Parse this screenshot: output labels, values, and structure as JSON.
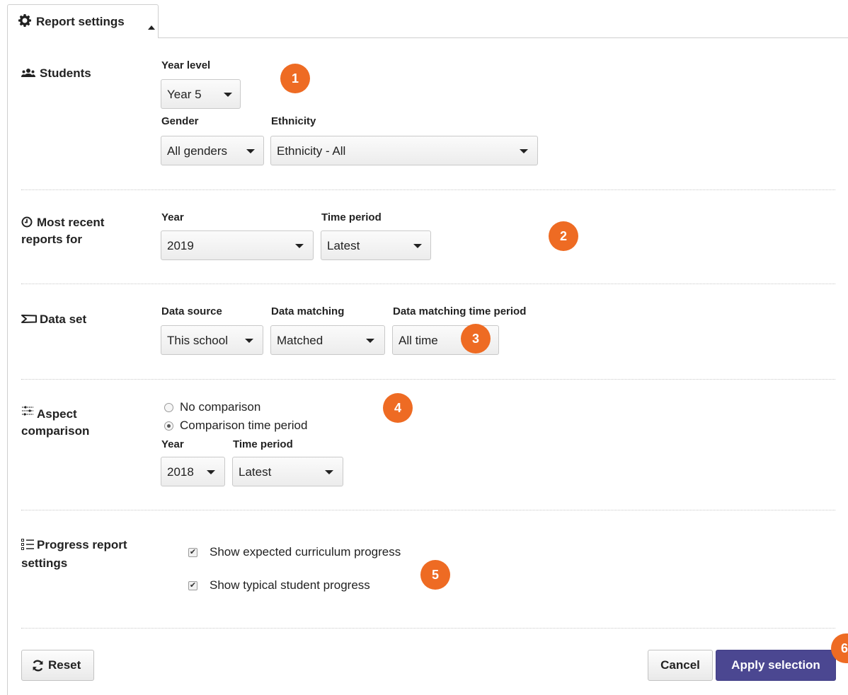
{
  "tab": {
    "label": "Report settings",
    "icon": "gear-icon"
  },
  "students": {
    "label": "Students",
    "icon": "users-icon",
    "year_level": {
      "label": "Year level",
      "value": "Year 5"
    },
    "gender": {
      "label": "Gender",
      "value": "All genders"
    },
    "ethnicity": {
      "label": "Ethnicity",
      "value": "Ethnicity - All"
    },
    "badge": "1"
  },
  "recent": {
    "label_line1": "Most recent",
    "label_line2": "reports for",
    "icon": "clock-icon",
    "year": {
      "label": "Year",
      "value": "2019"
    },
    "time_period": {
      "label": "Time period",
      "value": "Latest"
    },
    "badge": "2"
  },
  "dataset": {
    "label": "Data set",
    "icon": "funnel-icon",
    "source": {
      "label": "Data source",
      "value": "This school"
    },
    "matching": {
      "label": "Data matching",
      "value": "Matched"
    },
    "matching_period": {
      "label": "Data matching time period",
      "value": "All time"
    },
    "badge": "3"
  },
  "aspect": {
    "label_line1": "Aspect",
    "label_line2": "comparison",
    "icon": "sliders-icon",
    "options": [
      {
        "label": "No comparison",
        "selected": false
      },
      {
        "label": "Comparison time period",
        "selected": true
      }
    ],
    "year": {
      "label": "Year",
      "value": "2018"
    },
    "time_period": {
      "label": "Time period",
      "value": "Latest"
    },
    "badge": "4"
  },
  "progress": {
    "label_line1": "Progress report",
    "label_line2": "settings",
    "icon": "list-icon",
    "checks": [
      {
        "label": "Show expected curriculum progress",
        "checked": true
      },
      {
        "label": "Show typical student progress",
        "checked": true
      }
    ],
    "badge": "5"
  },
  "footer": {
    "reset_label": "Reset",
    "cancel_label": "Cancel",
    "apply_label": "Apply selection",
    "badge": "6"
  },
  "colors": {
    "accent": "#ee6b23",
    "primary": "#4b4791"
  }
}
